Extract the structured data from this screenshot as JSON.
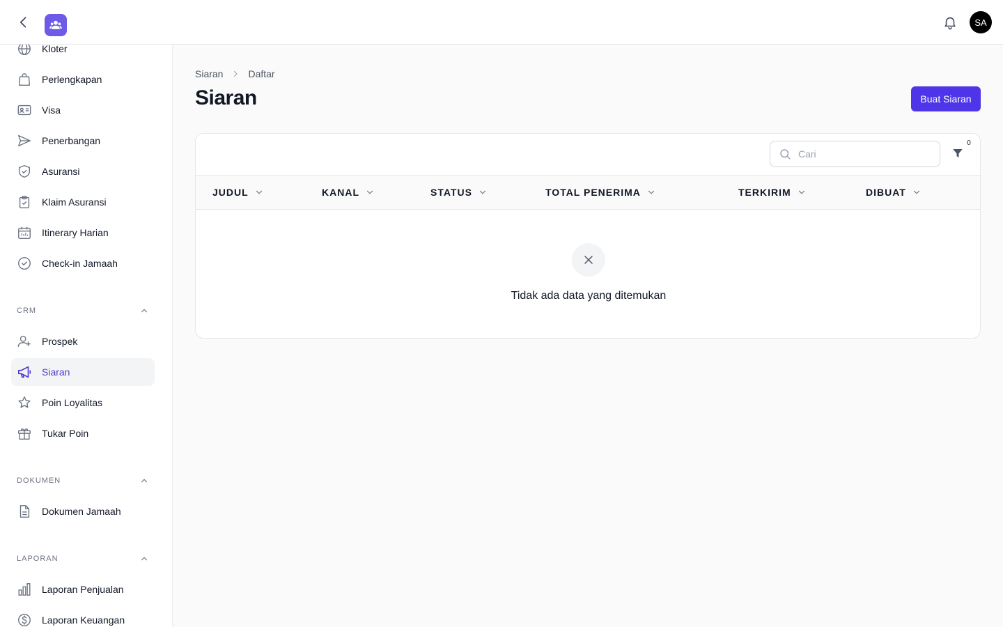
{
  "header": {
    "avatar_initials": "SA"
  },
  "sidebar": {
    "items_top": [
      {
        "label": "Kloter",
        "icon": "globe-icon"
      },
      {
        "label": "Perlengkapan",
        "icon": "shopping-bag-icon"
      },
      {
        "label": "Visa",
        "icon": "id-card-icon"
      },
      {
        "label": "Penerbangan",
        "icon": "send-icon"
      },
      {
        "label": "Asuransi",
        "icon": "shield-check-icon"
      },
      {
        "label": "Klaim Asuransi",
        "icon": "clipboard-check-icon"
      },
      {
        "label": "Itinerary Harian",
        "icon": "calendar-icon"
      },
      {
        "label": "Check-in Jamaah",
        "icon": "check-circle-icon"
      }
    ],
    "crm": {
      "title": "CRM",
      "items": [
        {
          "label": "Prospek",
          "icon": "user-plus-icon"
        },
        {
          "label": "Siaran",
          "icon": "megaphone-icon",
          "active": true
        },
        {
          "label": "Poin Loyalitas",
          "icon": "star-icon"
        },
        {
          "label": "Tukar Poin",
          "icon": "gift-icon"
        }
      ]
    },
    "dokumen": {
      "title": "DOKUMEN",
      "items": [
        {
          "label": "Dokumen Jamaah",
          "icon": "file-text-icon"
        }
      ]
    },
    "laporan": {
      "title": "LAPORAN",
      "items": [
        {
          "label": "Laporan Penjualan",
          "icon": "bar-chart-icon"
        },
        {
          "label": "Laporan Keuangan",
          "icon": "dollar-circle-icon"
        }
      ]
    }
  },
  "breadcrumb": {
    "root": "Siaran",
    "current": "Daftar"
  },
  "page": {
    "title": "Siaran",
    "create_button": "Buat Siaran"
  },
  "table": {
    "search_placeholder": "Cari",
    "filter_count": "0",
    "columns": [
      "JUDUL",
      "KANAL",
      "STATUS",
      "TOTAL PENERIMA",
      "TERKIRIM",
      "DIBUAT"
    ],
    "empty_message": "Tidak ada data yang ditemukan"
  },
  "colors": {
    "accent": "#4f35e8",
    "active_text": "#4f3cc9",
    "logo_bg": "#6d5ae6"
  }
}
